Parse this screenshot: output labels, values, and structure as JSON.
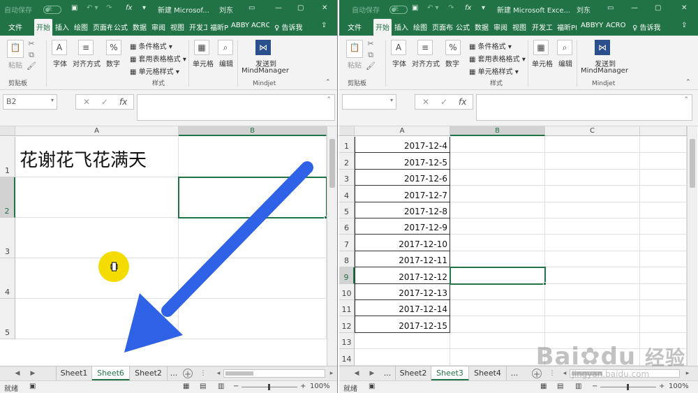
{
  "left_window": {
    "titlebar": {
      "autosave_label": "自动保存",
      "autosave_state": "关",
      "title": "新建 Microsof...",
      "user": "刘东"
    },
    "tabs": [
      "文件",
      "开始",
      "插入",
      "绘图",
      "页面布",
      "公式",
      "数据",
      "审阅",
      "视图",
      "开发工",
      "福昕P",
      "ABBY",
      "ACRO",
      "告诉我"
    ],
    "ribbon": {
      "paste": "粘贴",
      "font": "字体",
      "alignment": "对齐方式",
      "number": "数字",
      "cond_format": "条件格式",
      "table_format": "套用表格格式",
      "cell_style": "单元格样式",
      "cells": "单元格",
      "edit": "编辑",
      "send_to": "发送到",
      "mindmanager": "MindManager",
      "group_clipboard": "剪贴板",
      "group_style": "样式",
      "group_mindjet": "Mindjet"
    },
    "namebox": "B2",
    "columns": [
      "A",
      "B"
    ],
    "rows": [
      "1",
      "2",
      "3",
      "4",
      "5"
    ],
    "cell_a1": "花谢花飞花满天",
    "sheets": [
      "Sheet1",
      "Sheet6",
      "Sheet2",
      "..."
    ],
    "active_sheet": "Sheet6",
    "status": "就绪",
    "zoom": "100%"
  },
  "right_window": {
    "titlebar": {
      "autosave_label": "自动保存",
      "autosave_state": "关",
      "title": "新建 Microsoft Exce...",
      "user": "刘东"
    },
    "tabs": [
      "文件",
      "开始",
      "插入",
      "绘图",
      "页面布",
      "公式",
      "数据",
      "审阅",
      "视图",
      "开发工",
      "福昕PI",
      "ABBYY",
      "ACRO",
      "告诉我"
    ],
    "ribbon": {
      "paste": "粘贴",
      "font": "字体",
      "alignment": "对齐方式",
      "number": "数字",
      "cond_format": "条件格式",
      "table_format": "套用表格格式",
      "cell_style": "单元格样式",
      "cells": "单元格",
      "edit": "编辑",
      "send_to": "发送到",
      "mindmanager": "MindManager",
      "group_clipboard": "剪贴板",
      "group_style": "样式",
      "group_mindjet": "Mindjet"
    },
    "namebox": "",
    "columns": [
      "A",
      "B",
      "C"
    ],
    "rows": [
      "1",
      "2",
      "3",
      "4",
      "5",
      "6",
      "7",
      "8",
      "9",
      "10",
      "11",
      "12",
      "13",
      "14"
    ],
    "dates": [
      "2017-12-4",
      "2017-12-5",
      "2017-12-6",
      "2017-12-7",
      "2017-12-8",
      "2017-12-9",
      "2017-12-10",
      "2017-12-11",
      "2017-12-12",
      "2017-12-13",
      "2017-12-14",
      "2017-12-15"
    ],
    "sheets": [
      "...",
      "Sheet2",
      "Sheet3",
      "Sheet4",
      "..."
    ],
    "active_sheet": "Sheet3",
    "status": "就绪",
    "zoom": "100%"
  },
  "colors": {
    "excel_green": "#217346",
    "arrow_blue": "#2f62e6",
    "cursor_yellow": "#f5dc00"
  },
  "watermark": {
    "brand": "Bai",
    "brand2": "du",
    "cn": "经验",
    "url": "jingyan.baidu.com"
  }
}
